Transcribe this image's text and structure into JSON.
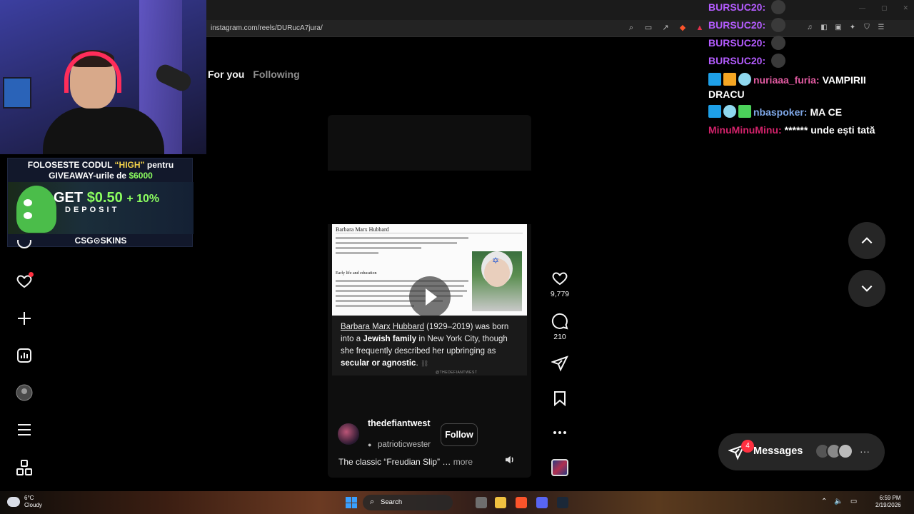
{
  "browser": {
    "url": "instagram.com/reels/DURucA7jura/",
    "window_controls": [
      "—",
      "▢",
      "✕"
    ]
  },
  "promo": {
    "line1_prefix": "FOLOSESTE CODUL",
    "line1_code": "“HIGH”",
    "line1_suffix": "pentru",
    "line2_prefix": "GIVEAWAY-urile de",
    "line2_amount": "$6000",
    "get_text": "GET",
    "get_amount": "$0.50",
    "get_bonus": "+ 10%",
    "deposit": "DEPOSIT",
    "brand": "CSG⊙SKINS"
  },
  "feed": {
    "tabs": [
      {
        "label": "For you",
        "active": true
      },
      {
        "label": "Following",
        "active": false
      }
    ]
  },
  "reel": {
    "wiki_title": "Barbara Marx Hubbard",
    "wiki_heading": "Early life and education",
    "caption_link": "Barbara Marx Hubbard",
    "caption_years": " (1929–2019) was born into a ",
    "caption_bold1": "Jewish family",
    "caption_place": " in New York City, though she frequently described her upbringing as ",
    "caption_bold2": "secular or agnostic",
    "caption_end": ".",
    "credit": "@THEDEFIANTWEST",
    "author": "thedefiantwest",
    "audio": "patrioticwester",
    "follow_label": "Follow",
    "description": "The classic “Freudian Slip” …",
    "more_label": "more"
  },
  "actions": {
    "likes": "9,779",
    "comments": "210"
  },
  "chat": {
    "lines": [
      {
        "user": "BURSUC20:",
        "msg": "",
        "color": "#b45cff"
      },
      {
        "user": "BURSUC20:",
        "msg": "",
        "color": "#b45cff"
      },
      {
        "user": "BURSUC20:",
        "msg": "",
        "color": "#b45cff"
      },
      {
        "user": "BURSUC20:",
        "msg": "",
        "color": "#b45cff"
      },
      {
        "user": "nuriaaa_furia:",
        "msg": "VAMPIRII DRACU",
        "color": "#e05aa0"
      },
      {
        "user": "nbaspoker:",
        "msg": "MA CE",
        "color": "#7fa8e8"
      },
      {
        "user": "MinuMinuMinu:",
        "msg": "****** unde ești tată",
        "color": "#d2226a"
      }
    ]
  },
  "messages": {
    "label": "Messages",
    "unread": "4"
  },
  "taskbar": {
    "temp": "6°C",
    "condition": "Cloudy",
    "search_label": "Search",
    "time": "6:59 PM",
    "date": "2/19/2026"
  },
  "colors": {
    "accent_red": "#ff3040",
    "background": "#000000"
  }
}
